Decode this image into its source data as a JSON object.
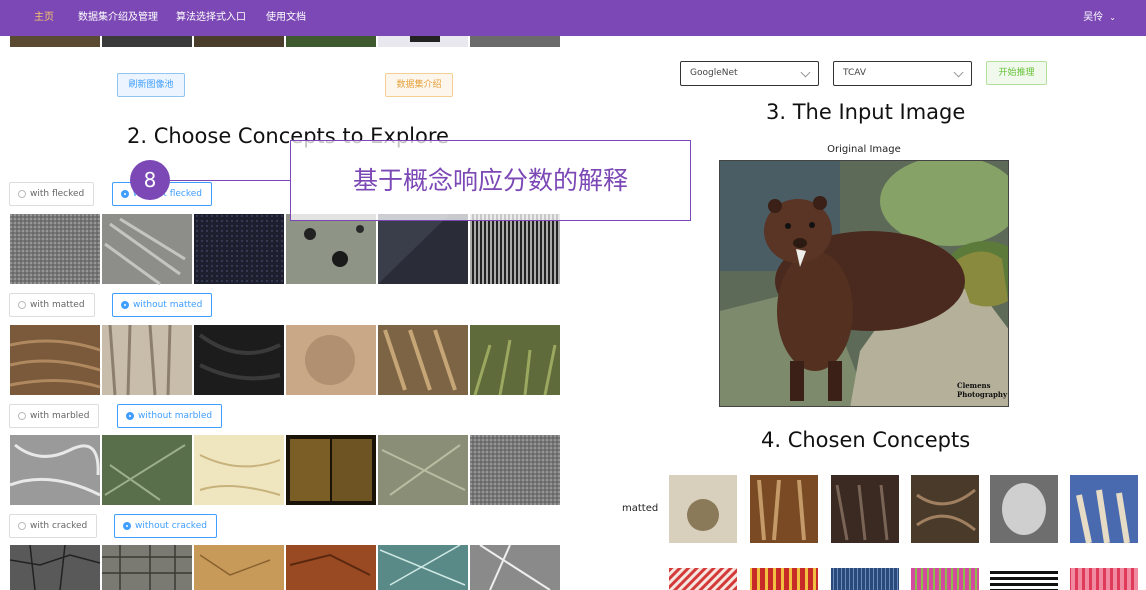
{
  "nav": {
    "items": [
      "主页",
      "数据集介绍及管理",
      "算法选择式入口",
      "使用文档"
    ],
    "active_index": 0,
    "user": "吴伶"
  },
  "left_controls": {
    "refresh_button": "刷新图像池",
    "dataset_button": "数据集介绍"
  },
  "section2": {
    "title": "2. Choose Concepts to Explore",
    "concepts": [
      {
        "with": "with flecked",
        "without": "without flecked",
        "selected": "without"
      },
      {
        "with": "with matted",
        "without": "without matted",
        "selected": "without"
      },
      {
        "with": "with marbled",
        "without": "without marbled",
        "selected": "without"
      },
      {
        "with": "with cracked",
        "without": "without cracked",
        "selected": "without"
      }
    ]
  },
  "right_controls": {
    "model_select": "GoogleNet",
    "method_select": "TCAV",
    "start_button": "开始推理"
  },
  "section3": {
    "title": "3. The Input Image",
    "image_caption": "Original Image",
    "watermark_line1": "Clemens",
    "watermark_line2": "Photography"
  },
  "section4": {
    "title": "4. Chosen Concepts",
    "concept_label": "matted"
  },
  "annotation": {
    "step_number": "8",
    "callout_text": "基于概念响应分数的解释"
  },
  "colors": {
    "nav_bg": "#7b48b5",
    "nav_active": "#f5c46b",
    "accent": "#409eff"
  }
}
